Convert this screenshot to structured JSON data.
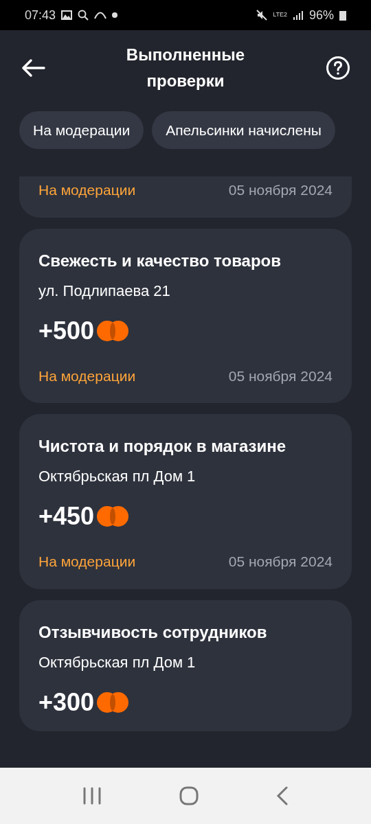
{
  "status_bar": {
    "time": "07:43",
    "battery": "96%",
    "network": "LTE2"
  },
  "header": {
    "title": "Выполненные проверки"
  },
  "filters": [
    {
      "label": "На модерации"
    },
    {
      "label": "Апельсинки начислены"
    }
  ],
  "checks": [
    {
      "status": "На модерации",
      "date": "05 ноября 2024"
    },
    {
      "title": "Свежесть и качество товаров",
      "address": "ул. Подлипаева 21",
      "points": "+500",
      "status": "На модерации",
      "date": "05 ноября 2024"
    },
    {
      "title": "Чистота и порядок в магазине",
      "address": "Октябрьская пл Дом 1",
      "points": "+450",
      "status": "На модерации",
      "date": "05 ноября 2024"
    },
    {
      "title": "Отзывчивость сотрудников",
      "address": "Октябрьская пл Дом 1",
      "points": "+300"
    }
  ]
}
